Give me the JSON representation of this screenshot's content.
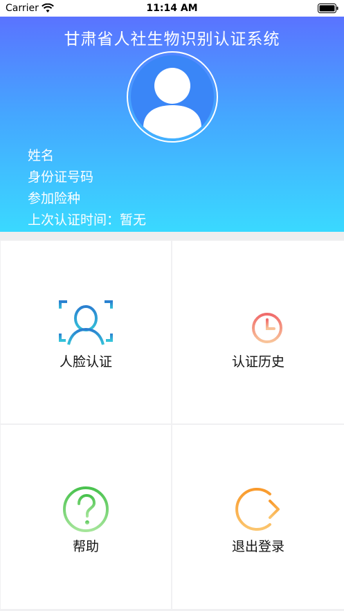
{
  "status_bar": {
    "carrier": "Carrier",
    "time": "11:14 AM"
  },
  "header": {
    "title": "甘肃省人社生物识别认证系统",
    "gradient_top": "#5a73ff",
    "gradient_bottom": "#3ad9ff"
  },
  "user_info": {
    "name_label": "姓名",
    "id_label": "身份证号码",
    "insurance_label": "参加险种",
    "last_auth": "上次认证时间：暂无"
  },
  "menu": {
    "face_auth": {
      "label": "人脸认证",
      "icon": "face-scan-icon",
      "color": "#2fb0d6"
    },
    "history": {
      "label": "认证历史",
      "icon": "history-clock-icon",
      "color": "#f4826e"
    },
    "help": {
      "label": "帮助",
      "icon": "question-circle-icon",
      "color": "#5ccb5c"
    },
    "logout": {
      "label": "退出登录",
      "icon": "logout-arrow-icon",
      "color": "#f9a23b"
    }
  }
}
